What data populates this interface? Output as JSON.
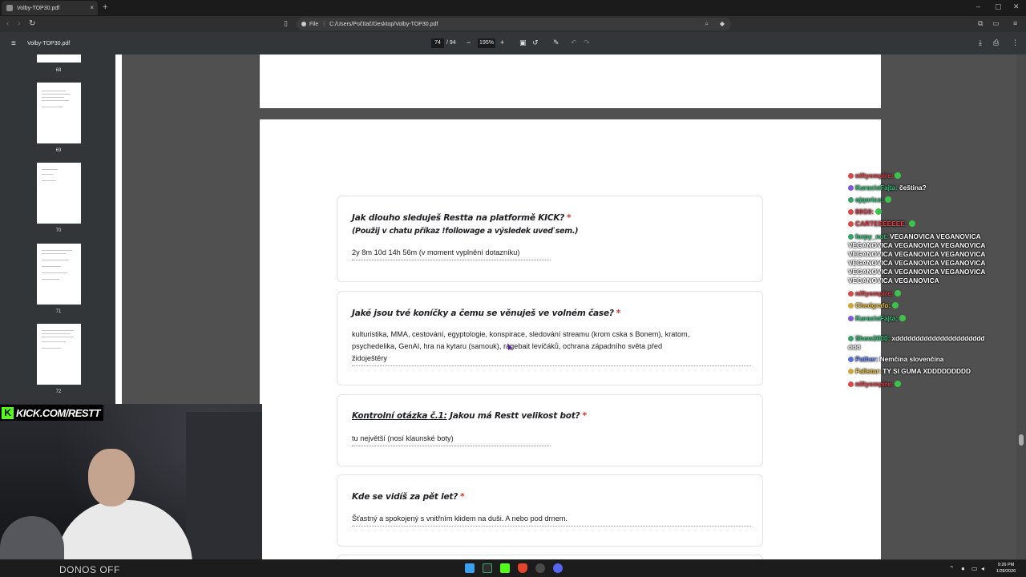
{
  "browser": {
    "tab_title": "Volby-TOP30.pdf",
    "tab_close": "×",
    "new_tab": "+",
    "win_min": "–",
    "win_max": "▢",
    "win_close": "✕",
    "url_scheme_label": "File",
    "url": "C:/Users/Počítač/Desktop/Volby-TOP30.pdf"
  },
  "pdf_toolbar": {
    "filename": "Volby-TOP30.pdf",
    "current_page": "74",
    "total_pages": "/ 94",
    "zoom": "195%",
    "zoom_minus": "−",
    "zoom_plus": "+"
  },
  "thumbnails": [
    {
      "num": "68"
    },
    {
      "num": "69"
    },
    {
      "num": "70"
    },
    {
      "num": "71"
    },
    {
      "num": "72"
    }
  ],
  "form": {
    "q1": {
      "question": "Jak dlouho sleduješ Restta na platformě KICK?",
      "required": "*",
      "hint": "(Použij v chatu příkaz !followage a výsledek uveď sem.)",
      "answer": "2y 8m 10d 14h 56m (v moment vyplnění dotazníku)"
    },
    "q2": {
      "question": "Jaké jsou tvé koníčky a čemu se věnuješ ve volném čase?",
      "required": "*",
      "answer_line1": "kulturistika, MMA, cestování, egyptologie, konspirace, sledování streamu (krom cska s Bonem), kratom,",
      "answer_line2": "psychedelika, GenAI, hra na kytaru (samouk), ragebait levičáků, ochrana západního světa před",
      "answer_line3": "židoještěry"
    },
    "q3": {
      "question_prefix": "Kontrolní otázka č.1:",
      "question_rest": " Jakou má Restt velikost bot?",
      "required": "*",
      "answer": "tu největší (nosí klaunské boty)"
    },
    "q4": {
      "question": "Kde se vidíš za pět let?",
      "required": "*",
      "answer": "Šťastný a spokojený s vnitřním klidem na duši. A nebo pod drnem."
    }
  },
  "chat": [
    {
      "user": "niftyempire:",
      "text": "",
      "user_color": "#e0404a"
    },
    {
      "user": "KuracioFajta:",
      "text": "čeština?",
      "user_color": "#2fc27a"
    },
    {
      "user": "ojqorica:",
      "text": "",
      "user_color": "#2fc27a"
    },
    {
      "user": "80G0:",
      "text": "",
      "user_color": "#e0404a"
    },
    {
      "user": "CARTEEEEEEE:",
      "text": "",
      "user_color": "#e0404a"
    },
    {
      "user": "forpy_not:",
      "text": "VEGANOVICA VEGANOVICA",
      "user_color": "#2fc27a"
    },
    {
      "user": "",
      "text": "VEGANOVICA VEGANOVICA VEGANOVICA",
      "user_color": "#ffffff"
    },
    {
      "user": "",
      "text": "VEGANOVICA VEGANOVICA VEGANOVICA",
      "user_color": "#ffffff"
    },
    {
      "user": "",
      "text": "VEGANOVICA VEGANOVICA VEGANOVICA",
      "user_color": "#ffffff"
    },
    {
      "user": "",
      "text": "VEGANOVICA VEGANOVICA VEGANOVICA",
      "user_color": "#ffffff"
    },
    {
      "user": "",
      "text": "VEGANOVICA VEGANOVICA",
      "user_color": "#ffffff"
    },
    {
      "user": "niftyempire:",
      "text": "",
      "user_color": "#e0404a"
    },
    {
      "user": "Chedgrafo:",
      "text": "",
      "user_color": "#e8c040"
    },
    {
      "user": "KuracioFajta:",
      "text": "",
      "user_color": "#2fc27a"
    },
    {
      "user": "Show2000:",
      "text": "xdddddddddddddddddddddd",
      "user_color": "#2fc27a"
    },
    {
      "user": "",
      "text": "ddd",
      "user_color": "#ffffff"
    },
    {
      "user": "Pather:",
      "text": "Nemčina slovenčina",
      "user_color": "#6a8cff"
    },
    {
      "user": "Fallstar:",
      "text": "TY SI GUMA XDDDDDDDDD",
      "user_color": "#e8c040"
    },
    {
      "user": "niftyempire:",
      "text": "",
      "user_color": "#e0404a"
    }
  ],
  "stream": {
    "banner": "KICK.COM/RESTT",
    "banner_logo": "K",
    "donos": "DONOS OFF"
  },
  "taskbar": {
    "time": "9:26 PM",
    "date": "1/28/2026"
  },
  "colors": {
    "required_star": "#d93025",
    "kick_green": "#53fc18",
    "toolbar_bg": "#323639"
  }
}
